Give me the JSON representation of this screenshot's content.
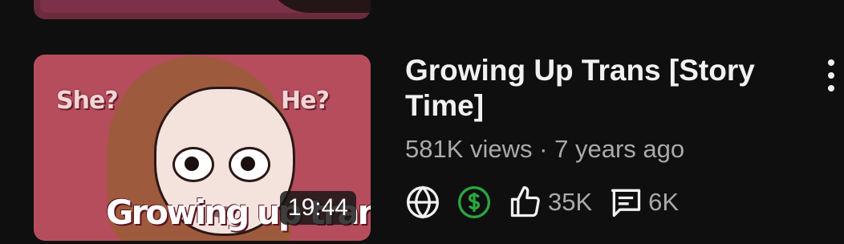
{
  "video": {
    "thumbnail_text": {
      "she": "She?",
      "he": "He?",
      "overlay_title": "Growing up trans"
    },
    "duration": "19:44",
    "title": "Growing Up Trans [Story Time]",
    "views": "581K views",
    "separator": "·",
    "age": "7 years ago",
    "likes": "35K",
    "comments": "6K",
    "icons": {
      "visibility": "globe-icon",
      "monetization": "dollar-icon",
      "likes": "thumbs-up-icon",
      "comments": "comment-icon",
      "menu": "more-vert-icon"
    },
    "colors": {
      "background": "#0f0f0f",
      "monetization": "#2ba640",
      "text_secondary": "#aaaaaa"
    }
  }
}
